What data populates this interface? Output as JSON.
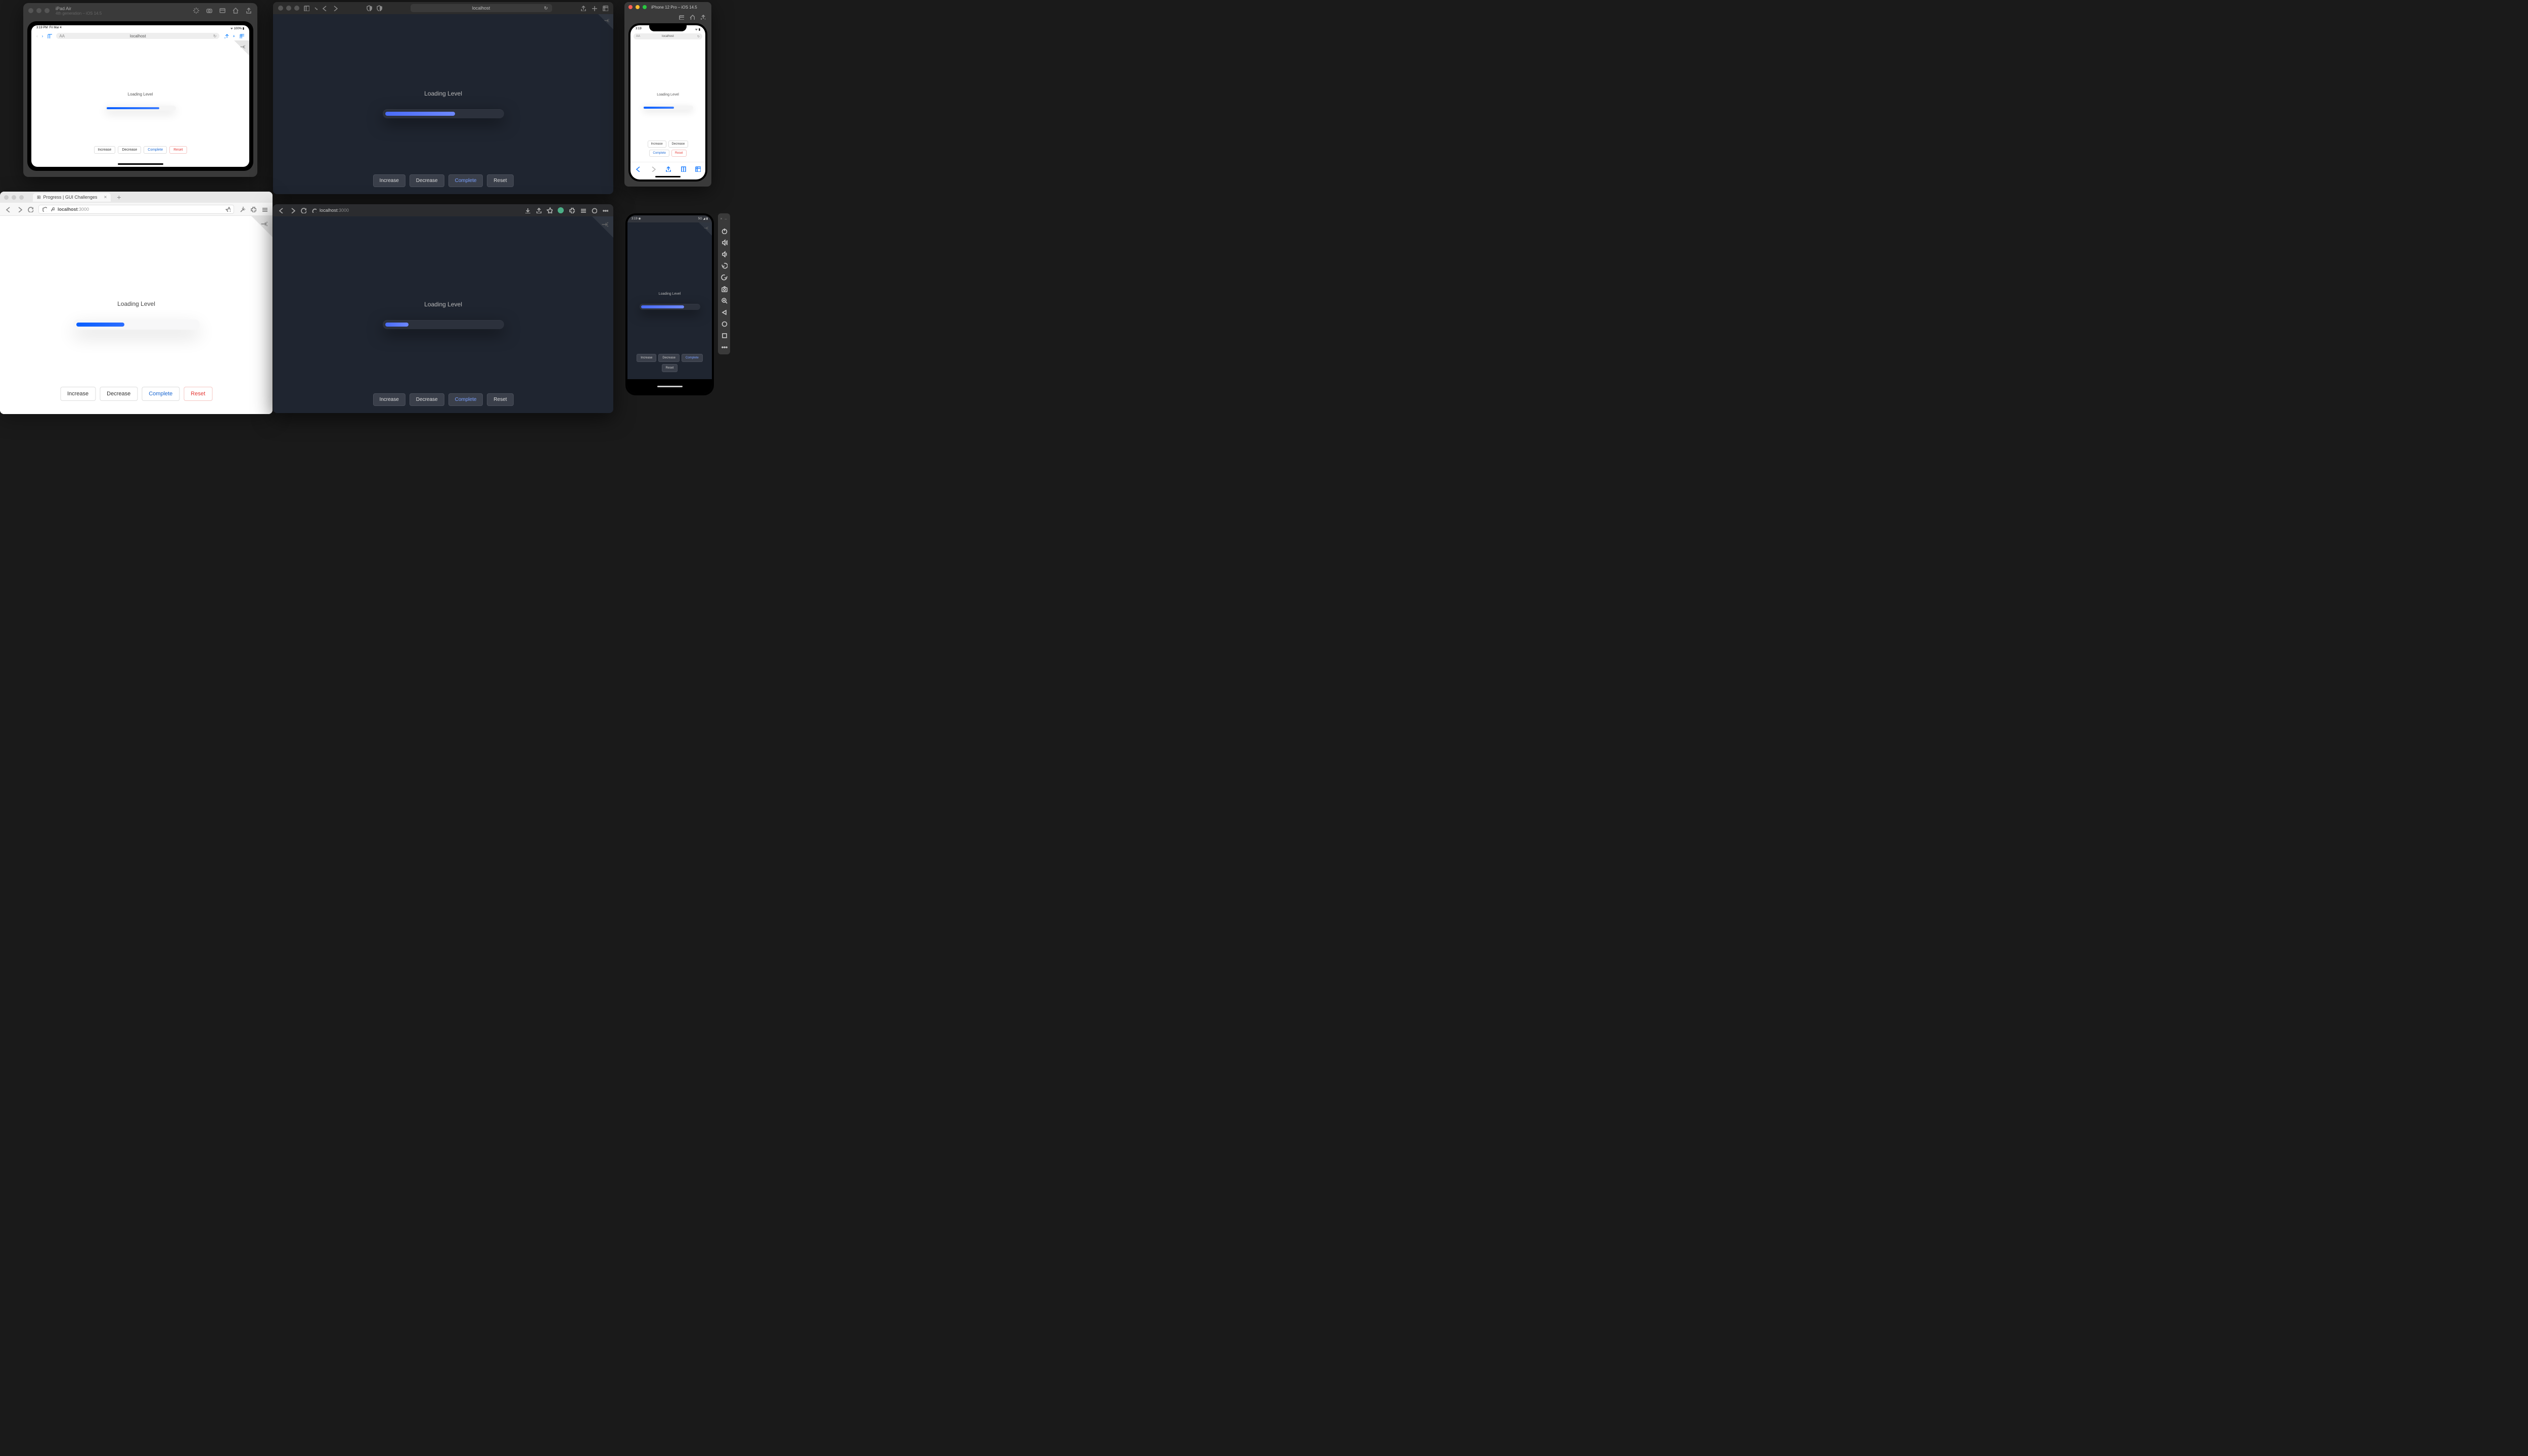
{
  "app": {
    "loading_label": "Loading Level",
    "buttons": {
      "increase": "Increase",
      "decrease": "Decrease",
      "complete": "Complete",
      "reset": "Reset"
    }
  },
  "progress": {
    "ipad_pct": 78,
    "safari_dark_pct": 60,
    "iphone_pct": 62,
    "firefox_pct": 40,
    "chrome_dark_pct": 20,
    "android_pct": 75
  },
  "ipad_sim": {
    "device_name": "iPad Air",
    "device_sub": "4th generation – iOS 14.5",
    "status_time": "3:19 PM",
    "status_date": "Fri Mar 4",
    "status_right": "100%",
    "url": "localhost",
    "url_reader": "AA",
    "url_reload": "↻"
  },
  "safari_dark": {
    "url": "localhost",
    "url_reload": "↻"
  },
  "iphone_sim": {
    "title": "iPhone 12 Pro – iOS 14.5",
    "status_time": "3:19",
    "url": "localhost",
    "url_reader": "AA",
    "url_reload": "↻"
  },
  "firefox": {
    "tab_title": "Progress | GUI Challenges",
    "tab_close": "×",
    "tab_new": "+",
    "url_host": "localhost",
    "url_port": ":3000"
  },
  "chrome": {
    "url_host": "localhost",
    "url_port": ":3000"
  },
  "android": {
    "status_time": "3:19",
    "status_right": "5G"
  },
  "colors": {
    "accent_light": "#0a5fff",
    "accent_dark": "#5a78f5",
    "complete": "#1967d2",
    "reset": "#e53935",
    "bg_dark_app": "#1f2530",
    "bg_light_app": "#ffffff"
  }
}
